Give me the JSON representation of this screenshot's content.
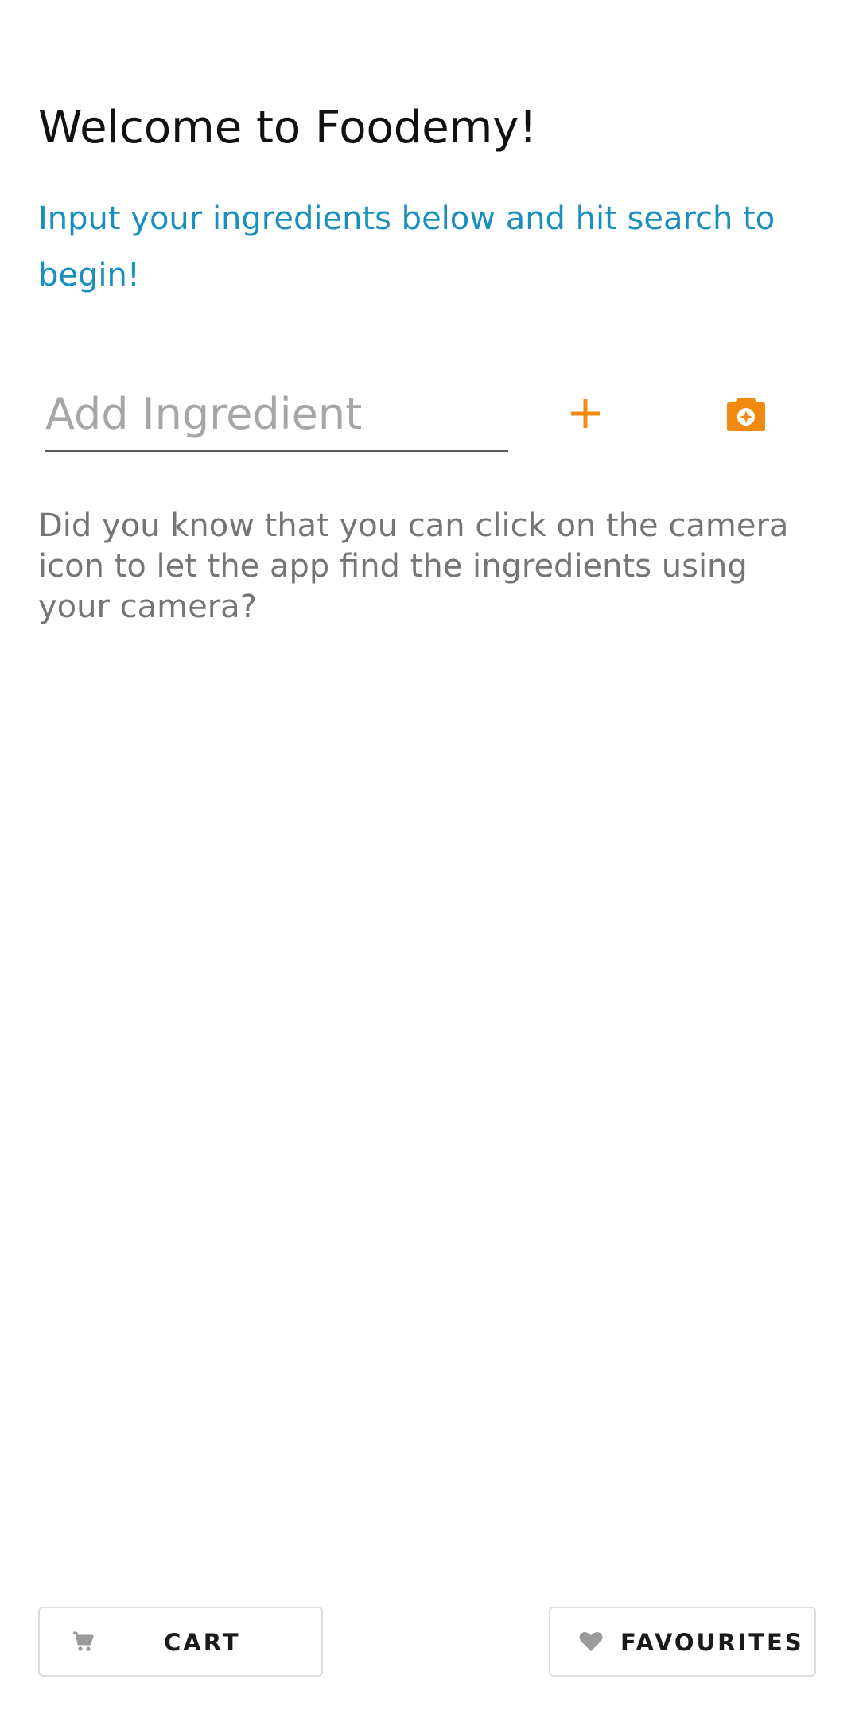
{
  "header": {
    "title": "Welcome to Foodemy!",
    "subtitle": "Input your ingredients below and hit search to begin!"
  },
  "ingredient_input": {
    "placeholder": "Add Ingredient",
    "value": ""
  },
  "hint": {
    "text": "Did you know that you can click on the camera icon to let the app find the ingredients using your camera?"
  },
  "bottom_bar": {
    "cart_label": "CART",
    "cart_icon": "cart-icon",
    "favourites_label": "FAVOURITES",
    "favourites_icon": "heart-icon"
  },
  "colors": {
    "accent": "#f28a10",
    "subtitle": "#1a8fbf",
    "hint": "#757575"
  }
}
